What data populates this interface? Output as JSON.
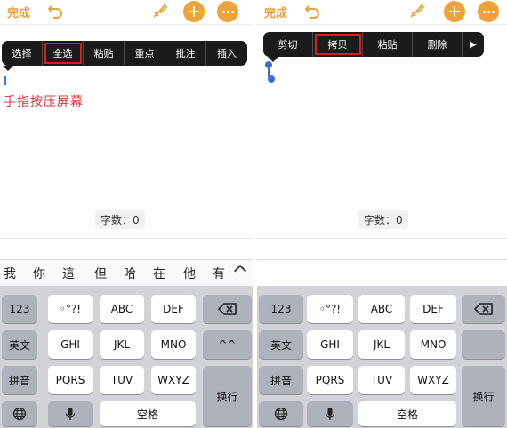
{
  "left": {
    "done_label": "完成",
    "menu_items": [
      "选择",
      "全选",
      "粘贴",
      "重点",
      "批注",
      "插入"
    ],
    "highlighted_item": "全选",
    "hint_text": "手指按压屏幕",
    "word_count": "字数：0",
    "suggestions": [
      "我",
      "你",
      "這",
      "但",
      "哈",
      "在",
      "他",
      "有"
    ]
  },
  "right": {
    "done_label": "完成",
    "menu_items": [
      "剪切",
      "拷贝",
      "粘贴",
      "删除"
    ],
    "highlighted_item": "拷贝",
    "more_arrow": "▶",
    "word_count": "字数：0"
  },
  "keyboard": {
    "row1": [
      "123",
      "◦°?!",
      "ABC",
      "DEF",
      "⌫"
    ],
    "row2": [
      "英文",
      "GHI",
      "JKL",
      "MNO",
      "^^"
    ],
    "row3": [
      "拼音",
      "PQRS",
      "TUV",
      "WXYZ"
    ],
    "enter": "换行",
    "space": "空格",
    "globe_icon": "globe-icon",
    "mic_icon": "mic-icon"
  },
  "colors": {
    "accent": "#f0a23a",
    "menu_bg": "#1b1b1b",
    "highlight": "#d61f1f",
    "hint": "#d43838",
    "selection": "#3a6fd1",
    "keyboard_bg": "#d1d3d9"
  }
}
